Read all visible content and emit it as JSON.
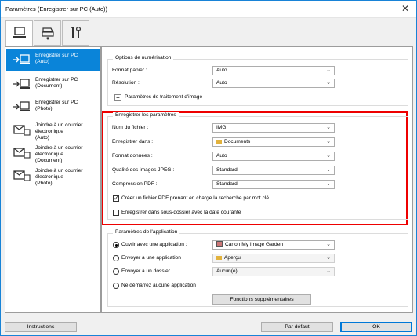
{
  "window": {
    "title": "Paramètres (Enregistrer sur PC (Auto))",
    "close_glyph": "✕"
  },
  "tabs": [
    {
      "name": "scan-from-computer",
      "icon": "computer-icon"
    },
    {
      "name": "scan-from-operation-panel",
      "icon": "scanner-icon"
    },
    {
      "name": "general-settings",
      "icon": "tools-icon"
    }
  ],
  "sidebar": {
    "items": [
      {
        "label": "Enregistrer sur PC\n(Auto)",
        "icon": "save-to-pc-icon"
      },
      {
        "label": "Enregistrer sur PC\n(Document)",
        "icon": "save-to-pc-icon"
      },
      {
        "label": "Enregistrer sur PC\n(Photo)",
        "icon": "save-to-pc-icon"
      },
      {
        "label": "Joindre à un courrier\nélectronique\n(Auto)",
        "icon": "email-icon"
      },
      {
        "label": "Joindre à un courrier\nélectronique\n(Document)",
        "icon": "email-icon"
      },
      {
        "label": "Joindre à un courrier\nélectronique\n(Photo)",
        "icon": "email-icon"
      }
    ]
  },
  "scan_options": {
    "title": "Options de numérisation",
    "paper_size_label": "Format papier :",
    "paper_size_value": "Auto",
    "resolution_label": "Résolution :",
    "resolution_value": "Auto",
    "image_processing_label": "Paramètres de traitement d'image",
    "plus": "+"
  },
  "save_settings": {
    "title": "Enregistrer les paramètres",
    "file_name_label": "Nom du fichier :",
    "file_name_value": "IMG",
    "save_in_label": "Enregistrer dans :",
    "save_in_value": "Documents",
    "data_format_label": "Format données :",
    "data_format_value": "Auto",
    "jpeg_quality_label": "Qualité des images JPEG :",
    "jpeg_quality_value": "Standard",
    "pdf_compression_label": "Compression PDF :",
    "pdf_compression_value": "Standard",
    "searchable_pdf_label": "Créer un fichier PDF prenant en charge la recherche par mot clé",
    "searchable_pdf_checked": true,
    "subfolder_label": "Enregistrer dans sous-dossier avec la date courante",
    "subfolder_checked": false
  },
  "app_settings": {
    "title": "Paramètres de l'application",
    "open_app_label": "Ouvrir avec une application :",
    "open_app_value": "Canon My Image Garden",
    "send_app_label": "Envoyer à une application :",
    "send_app_value": "Aperçu",
    "send_folder_label": "Envoyer à un dossier :",
    "send_folder_value": "Aucun(e)",
    "no_app_label": "Ne démarrez aucune application",
    "selected_option": "open_app",
    "more_functions_label": "Fonctions supplémentaires"
  },
  "footer": {
    "instructions_label": "Instructions",
    "defaults_label": "Par défaut",
    "ok_label": "OK"
  },
  "colors": {
    "accent": "#0a84d9",
    "highlight_frame": "#e00000"
  }
}
